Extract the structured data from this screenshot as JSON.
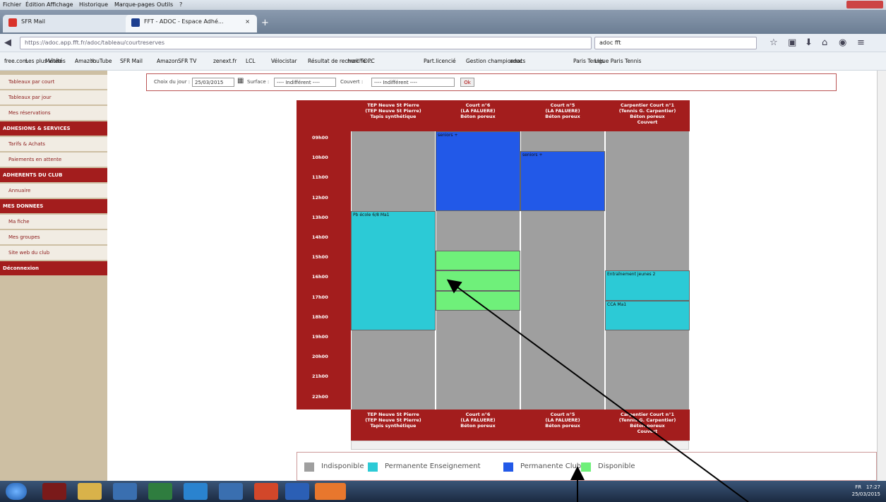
{
  "browser": {
    "menu": [
      "Fichier",
      "Édition",
      "Affichage",
      "Historique",
      "Marque-pages",
      "Outils",
      "?"
    ],
    "tabs": [
      {
        "label": "SFR Mail",
        "color": "#d9332b"
      },
      {
        "label": "FFT - ADOC - Espace Adhé...",
        "color": "#1d3f8f"
      }
    ],
    "url": "https://adoc.app.fft.fr/adoc/tableau/courtreserves",
    "search_value": "adoc fft",
    "bookmarks": [
      "free.com",
      "Les plus visités",
      "Météo",
      "Amazon",
      "YouTube",
      "SFR Mail",
      "Amazon",
      "SFR TV",
      "zenext.fr",
      "LCL",
      "Vélocistar",
      "Résultat de recherche ...",
      "mail TOPC",
      "Part.licencié",
      "Gestion championnats",
      "adoc",
      "Paris Tennis",
      "Ligue Paris Tennis"
    ]
  },
  "sidebar": {
    "items": [
      {
        "label": "Tableaux par court",
        "kind": "light"
      },
      {
        "label": "Tableaux par jour",
        "kind": "light"
      },
      {
        "label": "Mes réservations",
        "kind": "light"
      },
      {
        "label": "ADHESIONS & SERVICES",
        "kind": "dark"
      },
      {
        "label": "Tarifs & Achats",
        "kind": "light"
      },
      {
        "label": "Paiements en attente",
        "kind": "light"
      },
      {
        "label": "ADHERENTS DU CLUB",
        "kind": "dark"
      },
      {
        "label": "Annuaire",
        "kind": "light"
      },
      {
        "label": "MES DONNEES",
        "kind": "dark"
      },
      {
        "label": "Ma fiche",
        "kind": "light"
      },
      {
        "label": "Mes groupes",
        "kind": "light"
      },
      {
        "label": "Site web du club",
        "kind": "light"
      },
      {
        "label": "Déconnexion",
        "kind": "dark"
      }
    ]
  },
  "filter": {
    "day_label": "Choix du jour :",
    "day_value": "25/03/2015",
    "surface_label": "Surface :",
    "surface_value": "---- Indifférent ----",
    "covered_label": "Couvert :",
    "covered_value": "---- Indifférent ----",
    "ok_label": "Ok"
  },
  "courts": [
    {
      "name": "TEP Neuve St Pierre\n(TEP Neuve St Pierre)\nTapis synthétique"
    },
    {
      "name": "Court n°6\n(LA FALUERE)\nBéton poreux"
    },
    {
      "name": "Court n°5\n(LA FALUERE)\nBéton poreux"
    },
    {
      "name": "Carpentier Court n°1\n(Tennis G. Carpentier)\nBéton poreux\nCouvert"
    }
  ],
  "times": [
    "09h00",
    "10h00",
    "11h00",
    "12h00",
    "13h00",
    "14h00",
    "15h00",
    "16h00",
    "17h00",
    "18h00",
    "19h00",
    "20h00",
    "21h00",
    "22h00"
  ],
  "reservations": [
    {
      "court": 1,
      "start": 9,
      "end": 13,
      "label": "seniors +",
      "status": "permanente_club"
    },
    {
      "court": 2,
      "start": 10,
      "end": 13,
      "label": "seniors +",
      "status": "permanente_club"
    },
    {
      "court": 0,
      "start": 13,
      "end": 19,
      "label": "Pb école 6/8 Ma1",
      "status": "permanente_enseignement"
    },
    {
      "court": 1,
      "start": 15,
      "end": 16,
      "label": "",
      "status": "disponible"
    },
    {
      "court": 1,
      "start": 16,
      "end": 17,
      "label": "",
      "status": "disponible"
    },
    {
      "court": 1,
      "start": 17,
      "end": 18,
      "label": "",
      "status": "disponible"
    },
    {
      "court": 3,
      "start": 16,
      "end": 17.5,
      "label": "Entraînement jeunes 2",
      "status": "permanente_enseignement"
    },
    {
      "court": 3,
      "start": 17.5,
      "end": 19,
      "label": "CCA Ma1",
      "status": "permanente_enseignement"
    }
  ],
  "legend": [
    {
      "label": "Indisponible",
      "color": "#9f9f9f"
    },
    {
      "label": "Permanente Enseignement",
      "color": "#2ccad6"
    },
    {
      "label": "Permanente Club",
      "color": "#2259e8"
    },
    {
      "label": "Disponible",
      "color": "#6ff07a"
    }
  ],
  "clock": {
    "time": "17:27",
    "date": "25/03/2015",
    "lang": "FR"
  }
}
